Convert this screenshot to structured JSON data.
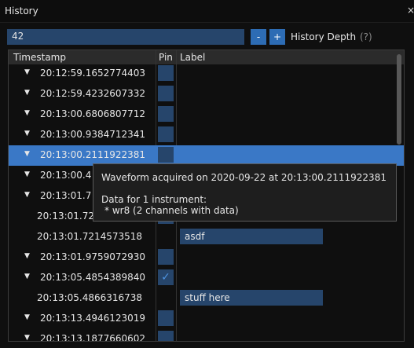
{
  "window": {
    "title": "History",
    "close_glyph": "×"
  },
  "controls": {
    "depth_value": "42",
    "minus_label": "-",
    "plus_label": "+",
    "depth_label": "History Depth",
    "help_label": "(?)"
  },
  "table": {
    "headers": {
      "timestamp": "Timestamp",
      "pin": "Pin",
      "label": "Label"
    },
    "rows": [
      {
        "timestamp": "20:12:59.1652774403",
        "expandable": true,
        "pin": "",
        "label": null,
        "selected": false
      },
      {
        "timestamp": "20:12:59.4232607332",
        "expandable": true,
        "pin": "",
        "label": null,
        "selected": false
      },
      {
        "timestamp": "20:13:00.6806807712",
        "expandable": true,
        "pin": "",
        "label": null,
        "selected": false
      },
      {
        "timestamp": "20:13:00.9384712341",
        "expandable": true,
        "pin": "",
        "label": null,
        "selected": false
      },
      {
        "timestamp": "20:13:00.2111922381",
        "expandable": true,
        "pin": "",
        "label": null,
        "selected": true
      },
      {
        "timestamp": "20:13:00.4",
        "expandable": true,
        "pin": "",
        "label": null,
        "selected": false
      },
      {
        "timestamp": "20:13:01.7",
        "expandable": true,
        "pin": "",
        "label": null,
        "selected": false
      },
      {
        "timestamp": "20:13:01.72",
        "expandable": false,
        "pin": "",
        "label": null,
        "selected": false
      },
      {
        "timestamp": "20:13:01.7214573518",
        "expandable": false,
        "pin": null,
        "label": "asdf",
        "selected": false
      },
      {
        "timestamp": "20:13:01.9759072930",
        "expandable": true,
        "pin": "",
        "label": null,
        "selected": false
      },
      {
        "timestamp": "20:13:05.4854389840",
        "expandable": true,
        "pin": "✓",
        "label": null,
        "selected": false
      },
      {
        "timestamp": "20:13:05.4866316738",
        "expandable": false,
        "pin": null,
        "label": "stuff here",
        "selected": false
      },
      {
        "timestamp": "20:13:13.4946123019",
        "expandable": true,
        "pin": "",
        "label": null,
        "selected": false
      },
      {
        "timestamp": "20:13:13.1877660602",
        "expandable": true,
        "pin": "",
        "label": null,
        "selected": false
      }
    ]
  },
  "tooltip": {
    "title": "Waveform acquired on 2020-09-22 at 20:13:00.2111922381",
    "line1": "Data for 1 instrument:",
    "line2": "* wr8 (2 channels with data)"
  },
  "colors": {
    "accent": "#3a78c6",
    "field": "#26456b",
    "button": "#2d6cb4"
  }
}
